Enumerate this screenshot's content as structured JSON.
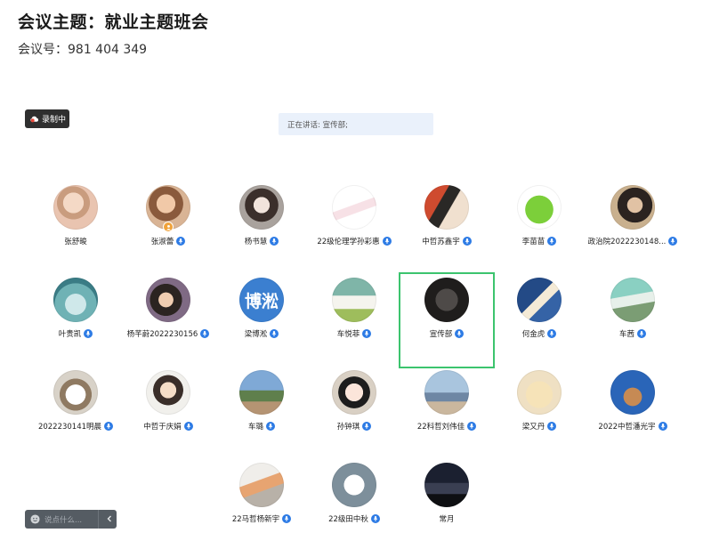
{
  "meeting": {
    "title": "会议主题：就业主题班会",
    "meeting_id": "会议号：981 404 349"
  },
  "recording": {
    "label": "录制中"
  },
  "speaker": {
    "text": "正在讲话: 宣传部;"
  },
  "chat": {
    "placeholder": "说点什么..."
  },
  "colors": {
    "active_border": "#3cc46e",
    "mic": "#2d7be5",
    "host_badge": "#f0a23a"
  },
  "participants": [
    {
      "name": "张舒畯",
      "mic": false,
      "host": false,
      "avatar": "photo-woman-1"
    },
    {
      "name": "张淑蕾",
      "mic": true,
      "host": true,
      "avatar": "photo-woman-2"
    },
    {
      "name": "杨书慧",
      "mic": true,
      "host": false,
      "avatar": "photo-woman-3"
    },
    {
      "name": "22级伦理学孙彩惠",
      "mic": true,
      "host": false,
      "avatar": "illustration-rabbit"
    },
    {
      "name": "中哲苏鑫宇",
      "mic": true,
      "host": false,
      "avatar": "illustration-cat"
    },
    {
      "name": "李苗苗",
      "mic": true,
      "host": false,
      "avatar": "green-apple"
    },
    {
      "name": "政治院2022230148...",
      "mic": true,
      "host": false,
      "avatar": "photo-woman-4"
    },
    {
      "name": "叶贵凯",
      "mic": true,
      "host": false,
      "avatar": "illustration-character"
    },
    {
      "name": "杨芊蔚2022230156",
      "mic": true,
      "host": false,
      "avatar": "photo-woman-5"
    },
    {
      "name": "梁博淞",
      "mic": true,
      "host": false,
      "avatar": "text",
      "avatar_text": "博淞"
    },
    {
      "name": "车悦菲",
      "mic": true,
      "host": false,
      "avatar": "photo-cup"
    },
    {
      "name": "宣传部",
      "mic": true,
      "host": false,
      "avatar": "photo-dark",
      "active": true
    },
    {
      "name": "何金虎",
      "mic": true,
      "host": false,
      "avatar": "photo-person-blue"
    },
    {
      "name": "车茜",
      "mic": true,
      "host": false,
      "avatar": "photo-woman-6"
    },
    {
      "name": "2022230141明晨",
      "mic": true,
      "host": false,
      "avatar": "photo-cat"
    },
    {
      "name": "中哲于庆娟",
      "mic": true,
      "host": false,
      "avatar": "photo-woman-7"
    },
    {
      "name": "车璐",
      "mic": true,
      "host": false,
      "avatar": "photo-outdoor"
    },
    {
      "name": "孙钟琪",
      "mic": true,
      "host": false,
      "avatar": "illustration-girl"
    },
    {
      "name": "22科哲刘伟佳",
      "mic": true,
      "host": false,
      "avatar": "photo-sky"
    },
    {
      "name": "梁又丹",
      "mic": true,
      "host": false,
      "avatar": "illustration-hand"
    },
    {
      "name": "2022中哲潘光宇",
      "mic": true,
      "host": false,
      "avatar": "illustration-blue-cat"
    },
    {
      "name": "22马哲杨新宇",
      "mic": true,
      "host": false,
      "avatar": "photo-flowers"
    },
    {
      "name": "22级田中秋",
      "mic": true,
      "host": false,
      "avatar": "photo-white-cat"
    },
    {
      "name": "常月",
      "mic": false,
      "host": false,
      "avatar": "photo-sunset"
    }
  ]
}
